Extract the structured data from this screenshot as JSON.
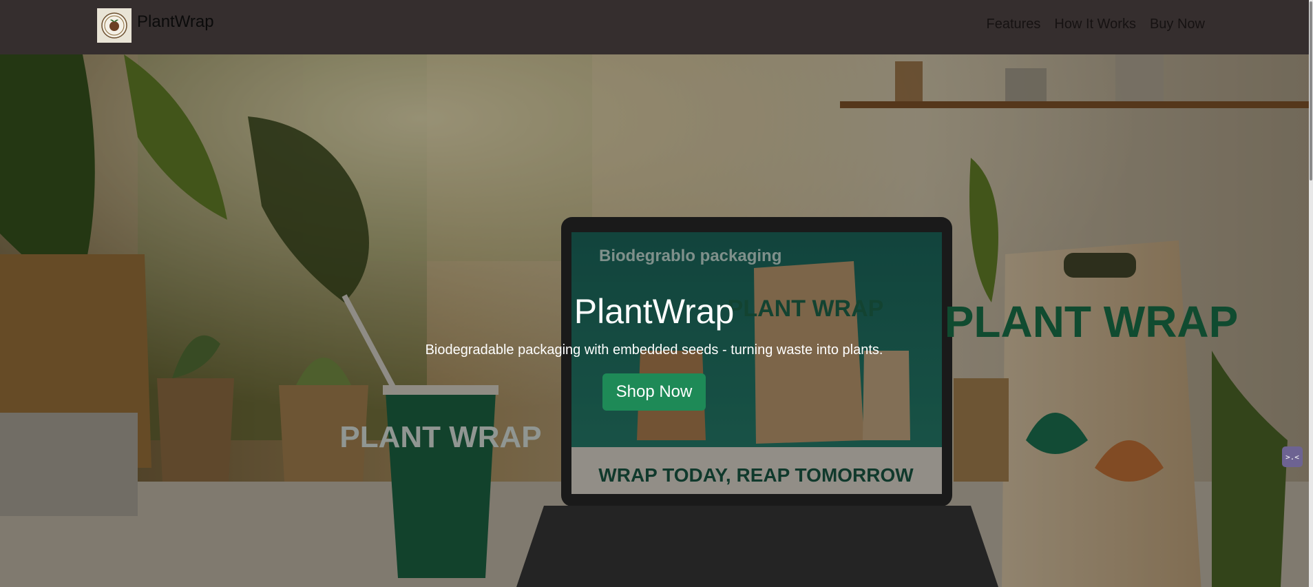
{
  "nav": {
    "brand": "PlantWrap",
    "links": [
      "Features",
      "How It Works",
      "Buy Now"
    ]
  },
  "hero": {
    "title": "PlantWrap",
    "subtitle": "Biodegradable packaging with embedded seeds - turning waste into plants.",
    "button": "Shop Now",
    "image_text": {
      "laptop_heading": "Biodegrablo packaging",
      "laptop_banner": "WRAP TODAY, REAP TOMORROW",
      "bag_brand": "PLANT WRAP",
      "cup_brand": "PLANT WRAP",
      "laptop_bag_brand": "PLANT WRAP"
    }
  },
  "widget": {
    "icon": "terminal-icon",
    "glyph": ">.<"
  },
  "colors": {
    "navbar": "#352e2e",
    "button": "#1e8a57",
    "brand_green": "#1a7a4e"
  }
}
